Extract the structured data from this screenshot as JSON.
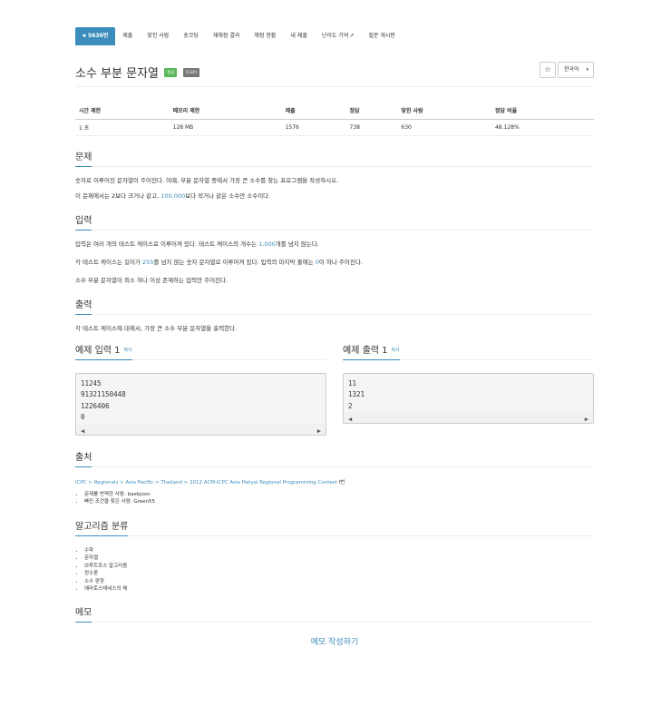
{
  "nav": {
    "tabs": [
      {
        "label": "5636번",
        "glyph": "⎈",
        "active": true
      },
      {
        "label": "제출"
      },
      {
        "label": "맞힌 사람"
      },
      {
        "label": "숏코딩"
      },
      {
        "label": "재채점 결과"
      },
      {
        "label": "채점 현황"
      },
      {
        "label": "내 제출"
      },
      {
        "label": "난이도 기여",
        "external": true
      },
      {
        "label": "질문 게시판"
      }
    ]
  },
  "header": {
    "title": "소수 부분 문자열",
    "badge_success": "성공",
    "badge_multilang": "다국어",
    "star": "☆",
    "language": "한국어"
  },
  "info": {
    "headers": [
      "시간 제한",
      "메모리 제한",
      "제출",
      "정답",
      "맞힌 사람",
      "정답 비율"
    ],
    "values": [
      "1 초",
      "128 MB",
      "1576",
      "738",
      "630",
      "48.128%"
    ]
  },
  "problem": {
    "heading": "문제",
    "p1": "숫자로 이루어진 문자열이 주어진다. 이때, 부분 문자열 중에서 가장 큰 소수를 찾는 프로그램을 작성하시오.",
    "p2_pre": "이 문제에서는 2보다 크거나 같고, ",
    "p2_num": "100,000",
    "p2_post": "보다 작거나 같은 소수만 소수이다."
  },
  "input": {
    "heading": "입력",
    "p1_pre": "입력은 여러 개의 테스트 케이스로 이루어져 있다. 테스트 케이스의 개수는 ",
    "p1_num": "1,000",
    "p1_post": "개를 넘지 않는다.",
    "p2_pre": "각 테스트 케이스는 길이가 ",
    "p2_num": "255",
    "p2_mid": "를 넘지 않는 숫자 문자열로 이루어져 있다. 입력의 마지막 줄에는 ",
    "p2_num2": "0",
    "p2_post": "이 하나 주어진다.",
    "p3": "소수 부분 문자열이 최소 하나 이상 존재하는 입력만 주어진다."
  },
  "output": {
    "heading": "출력",
    "p1": "각 테스트 케이스에 대해서, 가장 큰 소수 부분 문자열을 출력한다."
  },
  "examples": {
    "input_heading": "예제 입력 1",
    "output_heading": "예제 출력 1",
    "copy": "복사",
    "input_lines": [
      "11245",
      "91321150448",
      "1226406",
      "0"
    ],
    "output_lines": [
      "11",
      "1321",
      "2"
    ]
  },
  "source": {
    "heading": "출처",
    "crumbs": [
      "ICPC",
      "Regionals",
      "Asia Pacific",
      "Thailand",
      "2012 ACM-ICPC Asia Hatyai Regional Programming Contest"
    ],
    "suffix": " I번",
    "credits": [
      "문제를 번역한 사람: baekjoon",
      "빠진 조건을 찾은 사람: Green55"
    ]
  },
  "algorithms": {
    "heading": "알고리즘 분류",
    "items": [
      "수학",
      "문자열",
      "브루트포스 알고리즘",
      "정수론",
      "소수 판정",
      "에라토스테네스의 체"
    ]
  },
  "memo": {
    "heading": "메모",
    "link": "메모 작성하기"
  }
}
